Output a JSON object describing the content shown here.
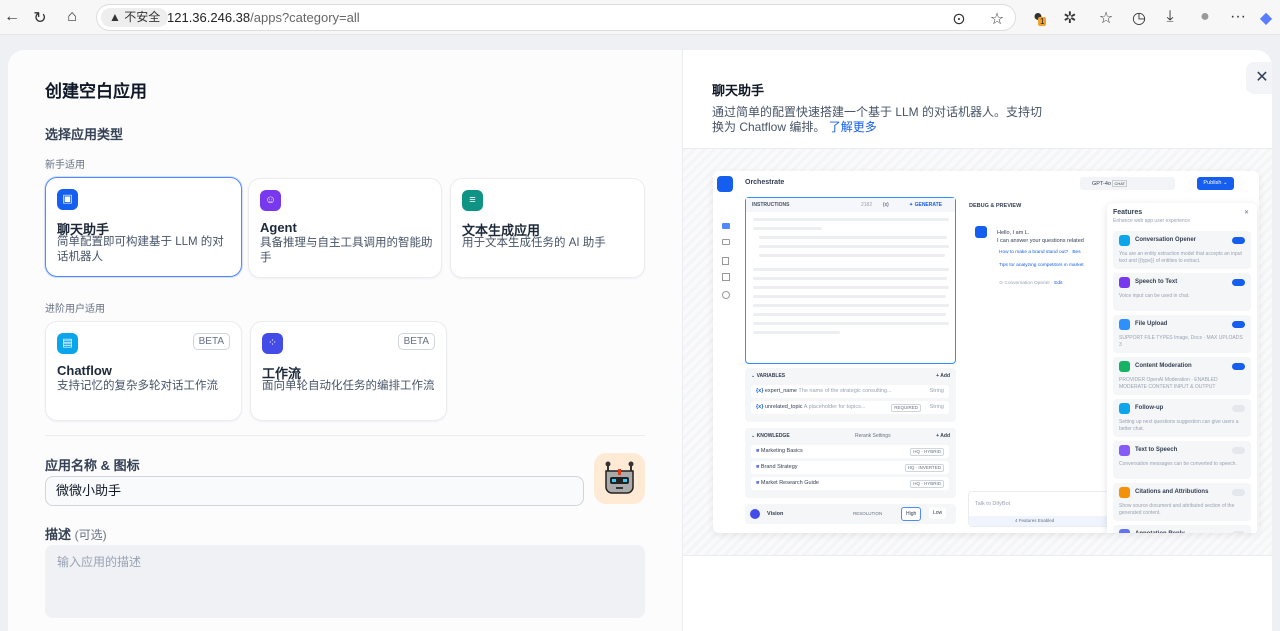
{
  "browser": {
    "insecure_label": "不安全",
    "url_host": "121.36.246.38",
    "url_path": "/apps?category=all",
    "extension_badge": "1"
  },
  "left": {
    "title": "创建空白应用",
    "section_type": "选择应用类型",
    "group_beginner": "新手适用",
    "group_advanced": "进阶用户适用",
    "cards": [
      {
        "title": "聊天助手",
        "desc": "简单配置即可构建基于 LLM 的对话机器人",
        "color": "#155eef",
        "selected": true
      },
      {
        "title": "Agent",
        "desc": "具备推理与自主工具调用的智能助手",
        "color": "#7839ee"
      },
      {
        "title": "文本生成应用",
        "desc": "用于文本生成任务的 AI 助手",
        "color": "#0e9384"
      },
      {
        "title": "Chatflow",
        "desc": "支持记忆的复杂多轮对话工作流",
        "color": "#0ba5ec",
        "badge": "BETA"
      },
      {
        "title": "工作流",
        "desc": "面向单轮自动化任务的编排工作流",
        "color": "#444ce7",
        "badge": "BETA"
      }
    ],
    "name_label": "应用名称 & 图标",
    "name_value": "微微小助手",
    "desc_label": "描述",
    "desc_optional": "(可选)",
    "desc_placeholder": "输入应用的描述"
  },
  "right": {
    "title": "聊天助手",
    "desc": "通过简单的配置快速搭建一个基于 LLM 的对话机器人。支持切换为 Chatflow 编排。",
    "learn_more": "了解更多",
    "preview": {
      "orchestrate": "Orchestrate",
      "model": "GPT-4o",
      "model_tag": "CHAT",
      "publish": "Publish",
      "instructions": "INSTRUCTIONS",
      "instr_count": "2182",
      "var_btn": "{x}",
      "generate": "GENERATE",
      "variables": "VARIABLES",
      "add": "+ Add",
      "vars": [
        {
          "name": "expert_name",
          "desc": "The name of the strategic consulting...",
          "type": "String"
        },
        {
          "name": "unrelated_topic",
          "desc": "A placeholder for topics...",
          "tag": "REQUIRED",
          "type": "String"
        }
      ],
      "knowledge": "KNOWLEDGE",
      "rerank": "Rerank Settings",
      "kb": [
        {
          "name": "Marketing Basics",
          "tag": "HQ · HYBRID"
        },
        {
          "name": "Brand Strategy",
          "tag": "HQ · INVERTED"
        },
        {
          "name": "Market Research Guide",
          "tag": "HQ · HYBRID"
        }
      ],
      "vision": "Vision",
      "resolution": "RESOLUTION",
      "high": "High",
      "low": "Low",
      "debug": "DEBUG & PREVIEW",
      "greeting1": "Hello, I am L.",
      "greeting2": "I can answer your questions related",
      "sugg1": "How to make a brand stand out?",
      "sugg2": "Bes",
      "sugg3": "Tips for analyzing competitors in market",
      "opener_note": "Conversation Opener",
      "edit": "Edit",
      "chat_placeholder": "Talk to DifyBot",
      "features_enabled": "4 Features Enabled",
      "features_title": "Features",
      "features_sub": "Enhance web app user experience",
      "features": [
        {
          "name": "Conversation Opener",
          "desc": "You are an entity extraction model that accepts an input text and {{type}} of entities to extract.",
          "on": true,
          "color": "#0ba5ec"
        },
        {
          "name": "Speech to Text",
          "desc": "Voice input can be used in chat.",
          "on": true,
          "color": "#7839ee"
        },
        {
          "name": "File Upload",
          "desc": "SUPPORT FILE TYPES Image, Docs · MAX UPLOADS 3",
          "on": true,
          "color": "#2e90fa"
        },
        {
          "name": "Content Moderation",
          "desc": "PROVIDER OpenAI Moderation · ENABLED MODERATE CONTENT INPUT & OUTPUT",
          "on": true,
          "color": "#16b364"
        },
        {
          "name": "Follow-up",
          "desc": "Setting up next questions suggestion can give users a better chat.",
          "on": false,
          "color": "#0ba5ec"
        },
        {
          "name": "Text to Speech",
          "desc": "Conversation messages can be converted to speech.",
          "on": false,
          "color": "#875bf7"
        },
        {
          "name": "Citations and Attributions",
          "desc": "Show source document and attributed section of the generated content.",
          "on": false,
          "color": "#f79009"
        },
        {
          "name": "Annotation Reply",
          "desc": "",
          "on": false,
          "color": "#6172f3"
        }
      ]
    }
  }
}
